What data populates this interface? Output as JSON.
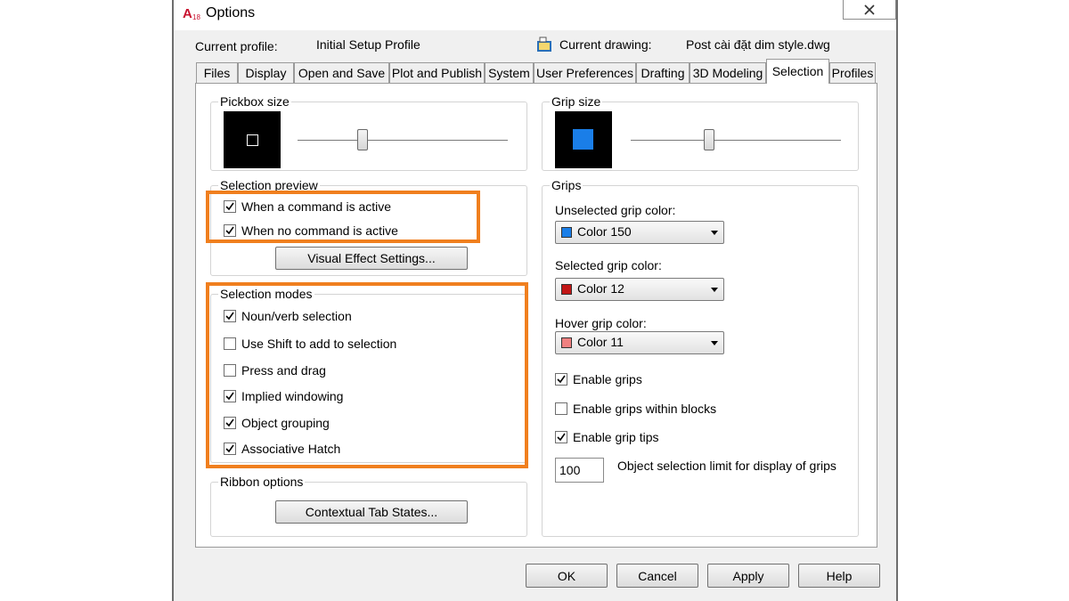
{
  "window": {
    "title": "Options",
    "app_icon_text": "A",
    "app_icon_sub": "18"
  },
  "header": {
    "current_profile_label": "Current profile:",
    "current_profile_value": "Initial Setup Profile",
    "current_drawing_label": "Current drawing:",
    "current_drawing_value": "Post cài đặt dim style.dwg"
  },
  "tabs": [
    {
      "label": "Files"
    },
    {
      "label": "Display"
    },
    {
      "label": "Open and Save"
    },
    {
      "label": "Plot and Publish"
    },
    {
      "label": "System"
    },
    {
      "label": "User Preferences"
    },
    {
      "label": "Drafting"
    },
    {
      "label": "3D Modeling"
    },
    {
      "label": "Selection",
      "active": true
    },
    {
      "label": "Profiles"
    }
  ],
  "pickbox": {
    "title": "Pickbox size"
  },
  "grip_size": {
    "title": "Grip size"
  },
  "selection_preview": {
    "title": "Selection preview",
    "options": [
      {
        "label": "When a command is active",
        "checked": true
      },
      {
        "label": "When no command is active",
        "checked": true
      }
    ],
    "visual_button": "Visual Effect Settings..."
  },
  "selection_modes": {
    "title": "Selection modes",
    "options": [
      {
        "label": "Noun/verb selection",
        "checked": true
      },
      {
        "label": "Use Shift to add to selection",
        "checked": false
      },
      {
        "label": "Press and drag",
        "checked": false
      },
      {
        "label": "Implied windowing",
        "checked": true
      },
      {
        "label": "Object grouping",
        "checked": true
      },
      {
        "label": "Associative Hatch",
        "checked": true
      }
    ]
  },
  "ribbon": {
    "title": "Ribbon options",
    "button": "Contextual Tab States..."
  },
  "grips": {
    "title": "Grips",
    "unselected_label": "Unselected grip color:",
    "unselected_value": "Color 150",
    "unselected_color": "#1a7ee8",
    "selected_label": "Selected grip color:",
    "selected_value": "Color 12",
    "selected_color": "#c21616",
    "hover_label": "Hover grip color:",
    "hover_value": "Color 11",
    "hover_color": "#f08080",
    "checks": [
      {
        "label": "Enable grips",
        "checked": true
      },
      {
        "label": "Enable grips within blocks",
        "checked": false
      },
      {
        "label": "Enable grip tips",
        "checked": true
      }
    ],
    "limit_value": "100",
    "limit_label": "Object selection limit for display of grips"
  },
  "footer": {
    "ok": "OK",
    "cancel": "Cancel",
    "apply": "Apply",
    "help": "Help"
  },
  "colors": {
    "highlight": "#f07f1e",
    "grip_preview": "#1a7ee8"
  }
}
